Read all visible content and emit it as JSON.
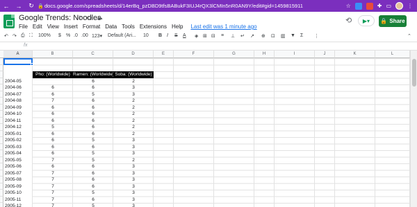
{
  "browser": {
    "url": "docs.google.com/spreadsheets/d/14erBq_pzDBD9tfsBABukF3IUJ4rQX3lCMIn5nR0AN9Y/edit#gid=1459815911",
    "back": "←",
    "forward": "→",
    "reload": "↻",
    "lock": "🔒"
  },
  "doc": {
    "title": "Google Trends: Noodles",
    "star": "☆",
    "move": "▭",
    "cloud": "☁",
    "menu": [
      "File",
      "Edit",
      "View",
      "Insert",
      "Format",
      "Data",
      "Tools",
      "Extensions",
      "Help"
    ],
    "last_edit": "Last edit was 1 minute ago",
    "share": "Share",
    "meet": "▶▾"
  },
  "toolbar": {
    "undo": "↶",
    "redo": "↷",
    "print": "⎙",
    "paint": "⛶",
    "zoom": "100%",
    "currency": "$",
    "percent": "%",
    "dec_less": ".0",
    "dec_more": ".00",
    "format": "123▾",
    "font": "Default (Ari...",
    "font_size": "10",
    "bold": "B",
    "italic": "I",
    "strike": "S",
    "text_color": "A",
    "fill": "◈",
    "borders": "⊞",
    "merge": "⊟",
    "align": "≡",
    "valign": "⊥",
    "wrap": "↵",
    "rotate": "↗",
    "link": "⊕",
    "comment": "⊡",
    "chart": "▥",
    "filter": "▼",
    "functions": "Σ",
    "more": "⋮",
    "collapse": "⌃"
  },
  "fxbar": {
    "fx": "fx"
  },
  "columns": [
    "A",
    "B",
    "C",
    "D",
    "E",
    "F",
    "G",
    "H",
    "I",
    "J",
    "K",
    "L"
  ],
  "header_row": [
    "Pho: (Worldwide)",
    "Ramen: (Worldwide)",
    "Soba: (Worldwide)"
  ],
  "rows": [
    [
      "2004-05",
      "",
      "6",
      "2"
    ],
    [
      "2004-06",
      "6",
      "6",
      "3"
    ],
    [
      "2004-07",
      "6",
      "5",
      "3"
    ],
    [
      "2004-08",
      "7",
      "6",
      "2"
    ],
    [
      "2004-09",
      "6",
      "6",
      "2"
    ],
    [
      "2004-10",
      "6",
      "6",
      "2"
    ],
    [
      "2004-11",
      "6",
      "6",
      "2"
    ],
    [
      "2004-12",
      "5",
      "6",
      "2"
    ],
    [
      "2005-01",
      "6",
      "6",
      "2"
    ],
    [
      "2005-02",
      "6",
      "5",
      "3"
    ],
    [
      "2005-03",
      "6",
      "6",
      "3"
    ],
    [
      "2005-04",
      "6",
      "5",
      "3"
    ],
    [
      "2005-05",
      "7",
      "5",
      "2"
    ],
    [
      "2005-06",
      "6",
      "6",
      "3"
    ],
    [
      "2005-07",
      "7",
      "6",
      "3"
    ],
    [
      "2005-08",
      "7",
      "6",
      "3"
    ],
    [
      "2005-09",
      "7",
      "6",
      "3"
    ],
    [
      "2005-10",
      "7",
      "5",
      "3"
    ],
    [
      "2005-11",
      "7",
      "6",
      "3"
    ],
    [
      "2005-12",
      "7",
      "5",
      "3"
    ]
  ]
}
